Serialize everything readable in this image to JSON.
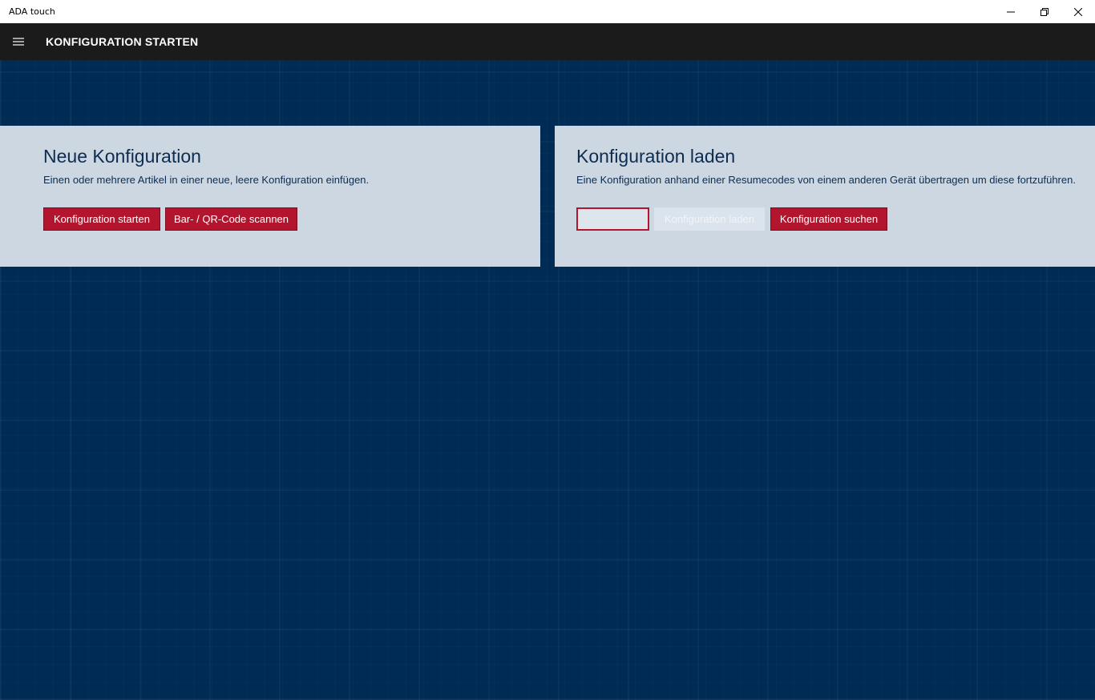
{
  "window": {
    "title": "ADA touch",
    "minimize_icon": "minimize-icon",
    "restore_icon": "restore-icon",
    "close_icon": "close-icon"
  },
  "appbar": {
    "menu_icon": "hamburger-icon",
    "title": "KONFIGURATION STARTEN"
  },
  "new_config": {
    "title": "Neue Konfiguration",
    "description": "Einen oder mehrere Artikel in einer neue, leere Konfiguration einfügen.",
    "start_button": "Konfiguration starten",
    "scan_button": "Bar- / QR-Code scannen"
  },
  "load_config": {
    "title": "Konfiguration laden",
    "description": "Eine Konfiguration anhand einer Resumecodes von einem anderen Gerät übertragen um diese fortzuführen.",
    "resume_code_value": "",
    "load_button": "Konfiguration laden",
    "load_button_state": "disabled",
    "search_button": "Konfiguration suchen"
  },
  "colors": {
    "background": "#002b55",
    "appbar": "#1b1b1b",
    "panel": "#cdd7e1",
    "accent": "#b3152e",
    "text": "#0d2c50"
  }
}
